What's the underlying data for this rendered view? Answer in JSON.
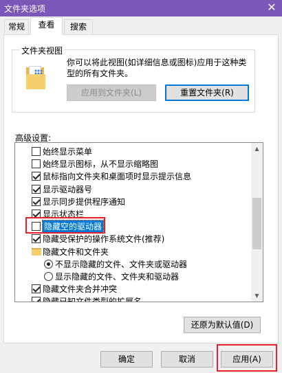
{
  "window": {
    "title": "文件夹选项",
    "close_glyph": "✕"
  },
  "tabs": [
    {
      "label": "常规",
      "active": false
    },
    {
      "label": "查看",
      "active": true
    },
    {
      "label": "搜索",
      "active": false
    }
  ],
  "folder_views": {
    "group_title": "文件夹视图",
    "description": "你可以将此视图(如详细信息或图标)应用于这种类型的所有文件夹。",
    "apply_button": "应用到文件夹(L)",
    "reset_button": "重置文件夹(R)"
  },
  "advanced": {
    "label": "高级设置:",
    "items": [
      {
        "kind": "checkbox",
        "checked": false,
        "label": "始终显示菜单",
        "indent": 0
      },
      {
        "kind": "checkbox",
        "checked": false,
        "label": "始终显示图标，从不显示缩略图",
        "indent": 0
      },
      {
        "kind": "checkbox",
        "checked": true,
        "label": "鼠标指向文件夹和桌面项时显示提示信息",
        "indent": 0
      },
      {
        "kind": "checkbox",
        "checked": true,
        "label": "显示驱动器号",
        "indent": 0
      },
      {
        "kind": "checkbox",
        "checked": true,
        "label": "显示同步提供程序通知",
        "indent": 0
      },
      {
        "kind": "checkbox",
        "checked": true,
        "label": "显示状态栏",
        "indent": 0
      },
      {
        "kind": "checkbox",
        "checked": false,
        "label": "隐藏空的驱动器",
        "indent": 0,
        "selected": true
      },
      {
        "kind": "checkbox",
        "checked": true,
        "label": "隐藏受保护的操作系统文件(推荐)",
        "indent": 0
      },
      {
        "kind": "folder",
        "label": "隐藏文件和文件夹",
        "indent": 0
      },
      {
        "kind": "radio",
        "checked": true,
        "label": "不显示隐藏的文件、文件夹或驱动器",
        "indent": 1
      },
      {
        "kind": "radio",
        "checked": false,
        "label": "显示隐藏的文件、文件夹和驱动器",
        "indent": 1
      },
      {
        "kind": "checkbox",
        "checked": true,
        "label": "隐藏文件夹合并冲突",
        "indent": 0
      },
      {
        "kind": "checkbox",
        "checked": true,
        "label": "隐藏已知文件类型的扩展名",
        "indent": 0
      }
    ],
    "restore_button": "还原为默认值(D)"
  },
  "footer": {
    "ok": "确定",
    "cancel": "取消",
    "apply": "应用(A)"
  },
  "colors": {
    "titlebar": "#7b58b8",
    "selection": "#0078d7",
    "highlight_box": "#e3202a"
  }
}
